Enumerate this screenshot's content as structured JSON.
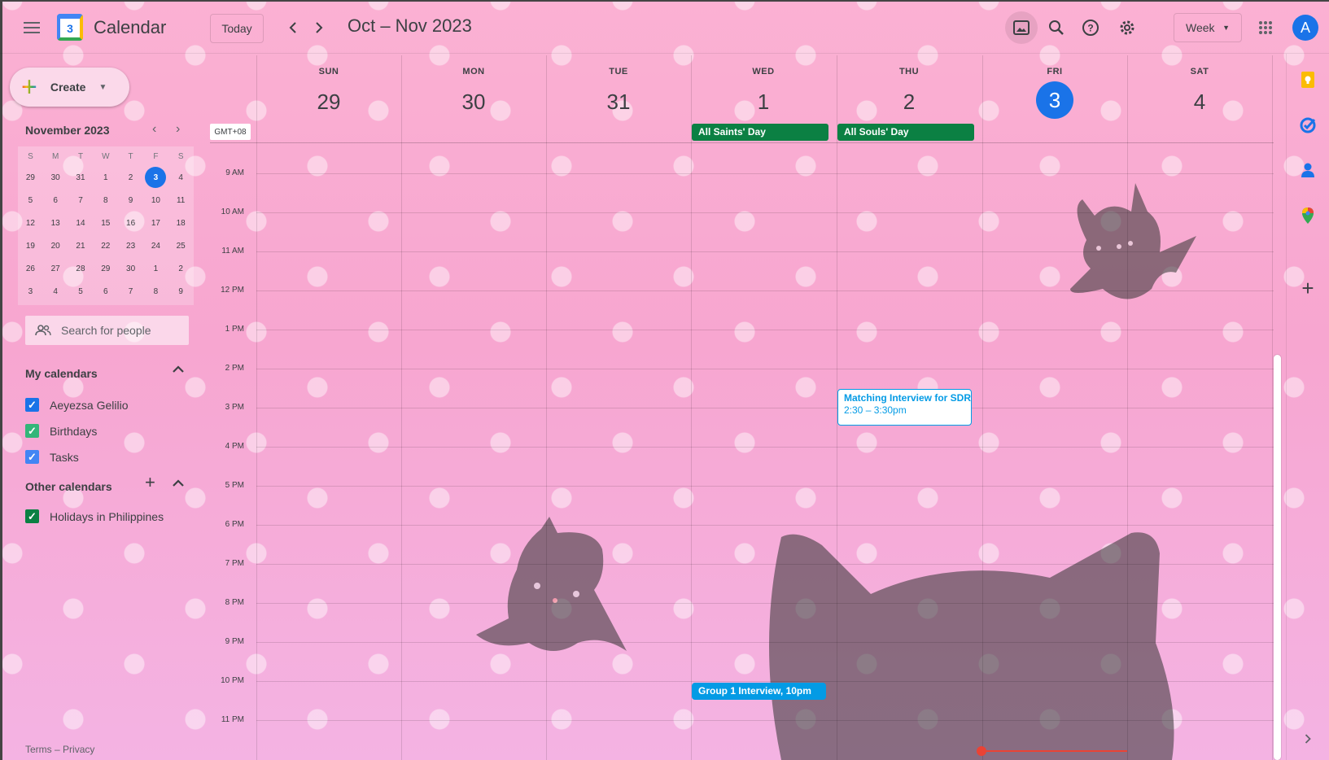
{
  "header": {
    "menu_icon": "hamburger-menu-icon",
    "app_logo_day": "3",
    "app_title": "Calendar",
    "today_label": "Today",
    "date_range": "Oct – Nov 2023",
    "view_label": "Week",
    "avatar_initial": "A"
  },
  "create": {
    "label": "Create"
  },
  "mini_calendar": {
    "title": "November 2023",
    "weekdays": [
      "S",
      "M",
      "T",
      "W",
      "T",
      "F",
      "S"
    ],
    "weeks": [
      [
        "29",
        "30",
        "31",
        "1",
        "2",
        "3",
        "4"
      ],
      [
        "5",
        "6",
        "7",
        "8",
        "9",
        "10",
        "11"
      ],
      [
        "12",
        "13",
        "14",
        "15",
        "16",
        "17",
        "18"
      ],
      [
        "19",
        "20",
        "21",
        "22",
        "23",
        "24",
        "25"
      ],
      [
        "26",
        "27",
        "28",
        "29",
        "30",
        "1",
        "2"
      ],
      [
        "3",
        "4",
        "5",
        "6",
        "7",
        "8",
        "9"
      ]
    ],
    "selected": "3"
  },
  "people_search": {
    "placeholder": "Search for people"
  },
  "my_calendars": {
    "title": "My calendars",
    "items": [
      {
        "label": "Aeyezsa Gelilio",
        "color": "#1a73e8"
      },
      {
        "label": "Birthdays",
        "color": "#33b679"
      },
      {
        "label": "Tasks",
        "color": "#4285f4"
      }
    ]
  },
  "other_calendars": {
    "title": "Other calendars",
    "items": [
      {
        "label": "Holidays in Philippines",
        "color": "#0b8043"
      }
    ]
  },
  "footer": {
    "terms": "Terms",
    "sep": "–",
    "privacy": "Privacy"
  },
  "week": {
    "timezone": "GMT+08",
    "days": [
      {
        "dow": "SUN",
        "num": "29"
      },
      {
        "dow": "MON",
        "num": "30"
      },
      {
        "dow": "TUE",
        "num": "31"
      },
      {
        "dow": "WED",
        "num": "1"
      },
      {
        "dow": "THU",
        "num": "2"
      },
      {
        "dow": "FRI",
        "num": "3",
        "today": true
      },
      {
        "dow": "SAT",
        "num": "4"
      }
    ],
    "hours": [
      "9 AM",
      "10 AM",
      "11 AM",
      "12 PM",
      "1 PM",
      "2 PM",
      "3 PM",
      "4 PM",
      "5 PM",
      "6 PM",
      "7 PM",
      "8 PM",
      "9 PM",
      "10 PM",
      "11 PM"
    ],
    "all_day_events": [
      {
        "title": "All Saints' Day",
        "day": 3
      },
      {
        "title": "All Souls' Day",
        "day": 4
      }
    ],
    "events": [
      {
        "title": "Matching Interview for SDR F",
        "time": "2:30 – 3:30pm"
      },
      {
        "title": "Group 1 Interview, 10pm"
      }
    ]
  },
  "colors": {
    "accent": "#1a73e8",
    "holiday": "#0b8043",
    "event": "#039be5",
    "now": "#ea4335"
  }
}
